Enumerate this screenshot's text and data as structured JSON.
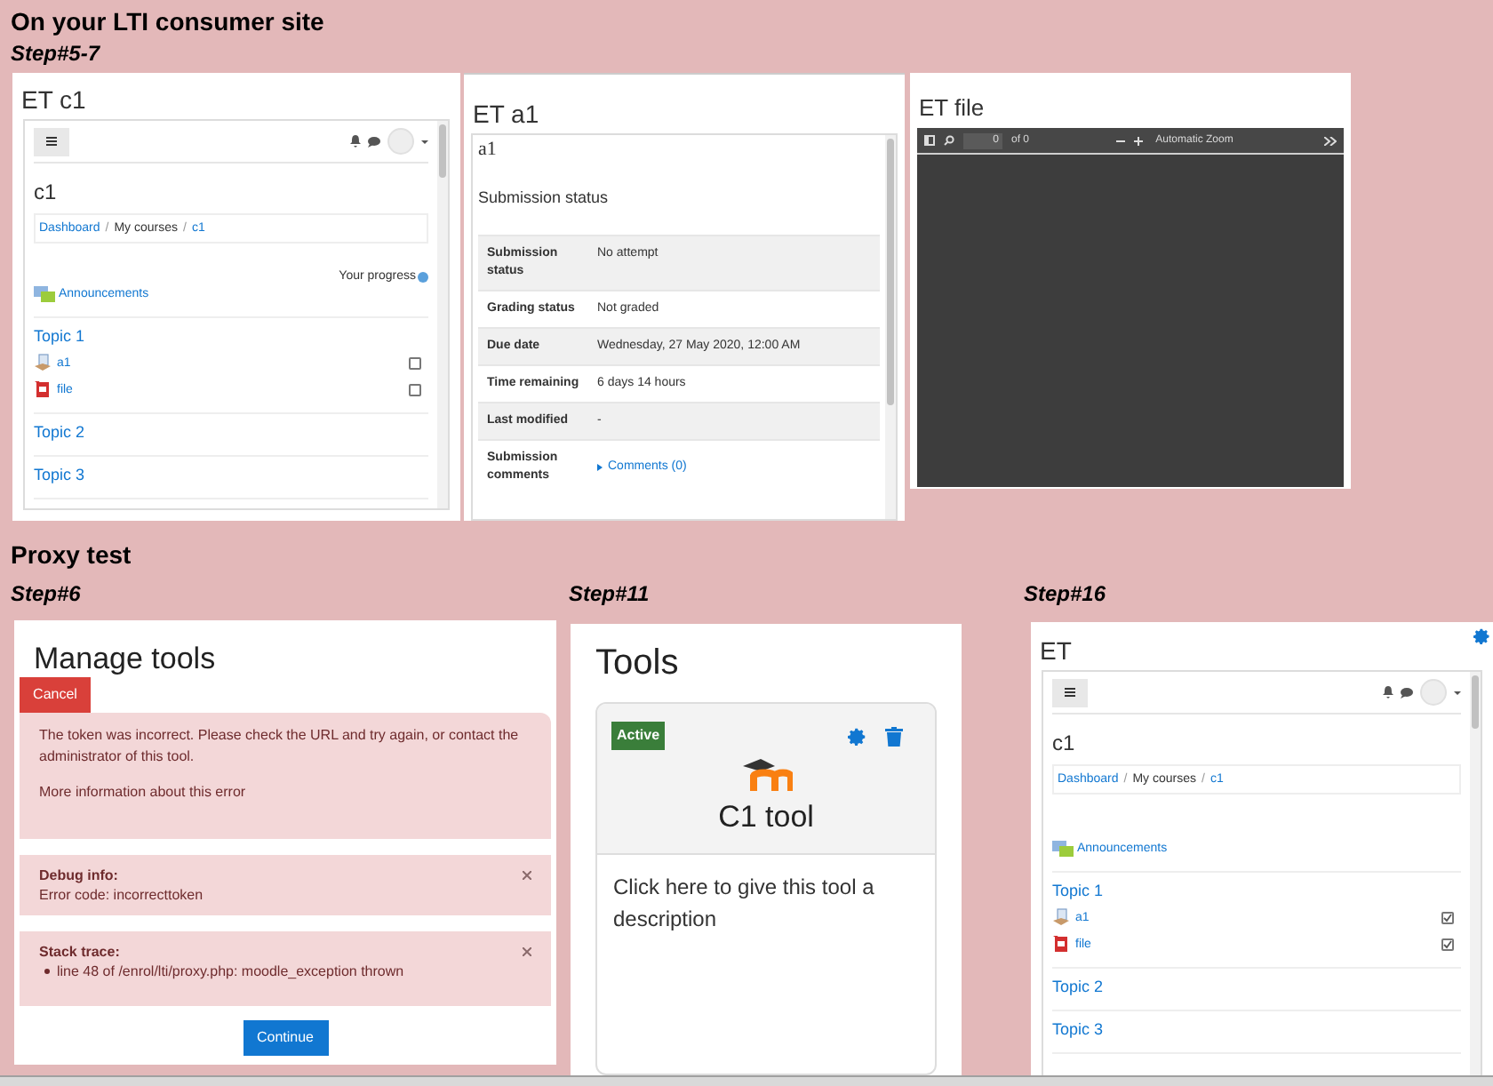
{
  "consumer_section": {
    "heading": "On your LTI consumer site",
    "step_label": "Step#5-7",
    "course_panel": {
      "title": "ET c1",
      "course_name": "c1",
      "breadcrumb": [
        {
          "text": "Dashboard",
          "kind": "link"
        },
        {
          "text": "/",
          "kind": "separator"
        },
        {
          "text": "My courses",
          "kind": "text"
        },
        {
          "text": "/",
          "kind": "separator"
        },
        {
          "text": "c1",
          "kind": "link"
        }
      ],
      "progress_label": "Your progress",
      "announcements": "Announcements",
      "topics": [
        {
          "name": "Topic 1",
          "activities": [
            {
              "name": "a1",
              "kind": "assignment",
              "checked": false
            },
            {
              "name": "file",
              "kind": "pdf",
              "checked": false
            }
          ]
        },
        {
          "name": "Topic 2"
        },
        {
          "name": "Topic 3"
        }
      ]
    },
    "assignment_panel": {
      "title": "ET a1",
      "assignment_name": "a1",
      "section_title": "Submission status",
      "rows": [
        {
          "label": "Submission status",
          "value": "No attempt",
          "kind": "text"
        },
        {
          "label": "Grading status",
          "value": "Not graded",
          "kind": "text"
        },
        {
          "label": "Due date",
          "value": "Wednesday, 27 May 2020, 12:00 AM",
          "kind": "text"
        },
        {
          "label": "Time remaining",
          "value": "6 days 14 hours",
          "kind": "text"
        },
        {
          "label": "Last modified",
          "value": "-",
          "kind": "text"
        },
        {
          "label": "Submission comments",
          "value": "Comments (0)",
          "kind": "link"
        }
      ]
    },
    "file_panel": {
      "title": "ET file",
      "page_number": "0",
      "page_count": "of 0",
      "zoom": "Automatic Zoom"
    }
  },
  "proxy_section": {
    "heading": "Proxy test",
    "error_step": {
      "step_label": "Step#6",
      "title": "Manage tools",
      "cancel": "Cancel",
      "message": "The token was incorrect. Please check the URL and try again, or contact the administrator of this tool.",
      "more_info": "More information about this error",
      "debug_title": "Debug info:",
      "debug_text": "Error code: incorrecttoken",
      "stack_title": "Stack trace:",
      "stack_items": [
        "line 48 of /enrol/lti/proxy.php: moodle_exception thrown"
      ],
      "continue": "Continue"
    },
    "tools_step": {
      "step_label": "Step#11",
      "title": "Tools",
      "status": "Active",
      "tool_name": "C1 tool",
      "description": "Click here to give this tool a description"
    },
    "course_step": {
      "step_label": "Step#16",
      "title": "ET",
      "course_name": "c1",
      "breadcrumb": [
        {
          "text": "Dashboard",
          "kind": "link"
        },
        {
          "text": "/",
          "kind": "separator"
        },
        {
          "text": "My courses",
          "kind": "text"
        },
        {
          "text": "/",
          "kind": "separator"
        },
        {
          "text": "c1",
          "kind": "link"
        }
      ],
      "announcements": "Announcements",
      "topics": [
        {
          "name": "Topic 1",
          "activities": [
            {
              "name": "a1",
              "kind": "assignment",
              "checked": true
            },
            {
              "name": "file",
              "kind": "pdf",
              "checked": true
            }
          ]
        },
        {
          "name": "Topic 2"
        },
        {
          "name": "Topic 3"
        }
      ]
    }
  }
}
